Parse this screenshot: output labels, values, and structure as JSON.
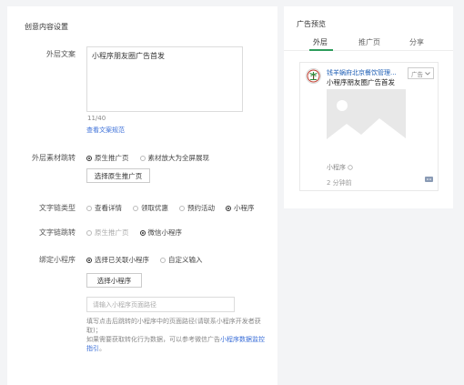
{
  "left": {
    "section_title": "创意内容设置",
    "outer_copy": {
      "label": "外层文案",
      "value": "小程序朋友圈广告首发",
      "count": "11/40",
      "spec_link": "查看文案规范"
    },
    "material_jump": {
      "label": "外层素材跳转",
      "options": [
        "原生推广页",
        "素材放大为全屏展现"
      ],
      "selected_index": 0,
      "button": "选择原生推广页"
    },
    "text_link_type": {
      "label": "文字链类型",
      "options": [
        "查看详情",
        "领取优惠",
        "预约活动",
        "小程序"
      ],
      "selected_index": 3
    },
    "text_link_jump": {
      "label": "文字链跳转",
      "options": [
        "原生推广页",
        "微信小程序"
      ],
      "selected_index": 1
    },
    "bind_mini": {
      "label": "绑定小程序",
      "options": [
        "选择已关联小程序",
        "自定义输入"
      ],
      "selected_index": 0,
      "button": "选择小程序",
      "input_placeholder": "请输入小程序页面路径",
      "help_line1": "填写点击后跳转的小程序中的页面路径(请联系小程序开发者获取)；",
      "help_line2_prefix": "如果需要获取转化行为数据，可以参考微信广告",
      "help_line2_link": "小程序数据监控指引",
      "help_line2_suffix": "。"
    }
  },
  "preview": {
    "title": "广告预览",
    "tabs": [
      "外层",
      "推广页",
      "分享"
    ],
    "active_tab": 0,
    "card": {
      "advertiser": "钱羊蜗府北京餐饮管理...",
      "ad_badge": "广告",
      "ad_text": "小程序朋友圈广告首发",
      "mini_program_label": "小程序",
      "time": "2 分钟前"
    }
  },
  "colors": {
    "accent_green": "#2d9c5b",
    "link_blue": "#3b6fd8",
    "background": "#f3f4f6"
  }
}
